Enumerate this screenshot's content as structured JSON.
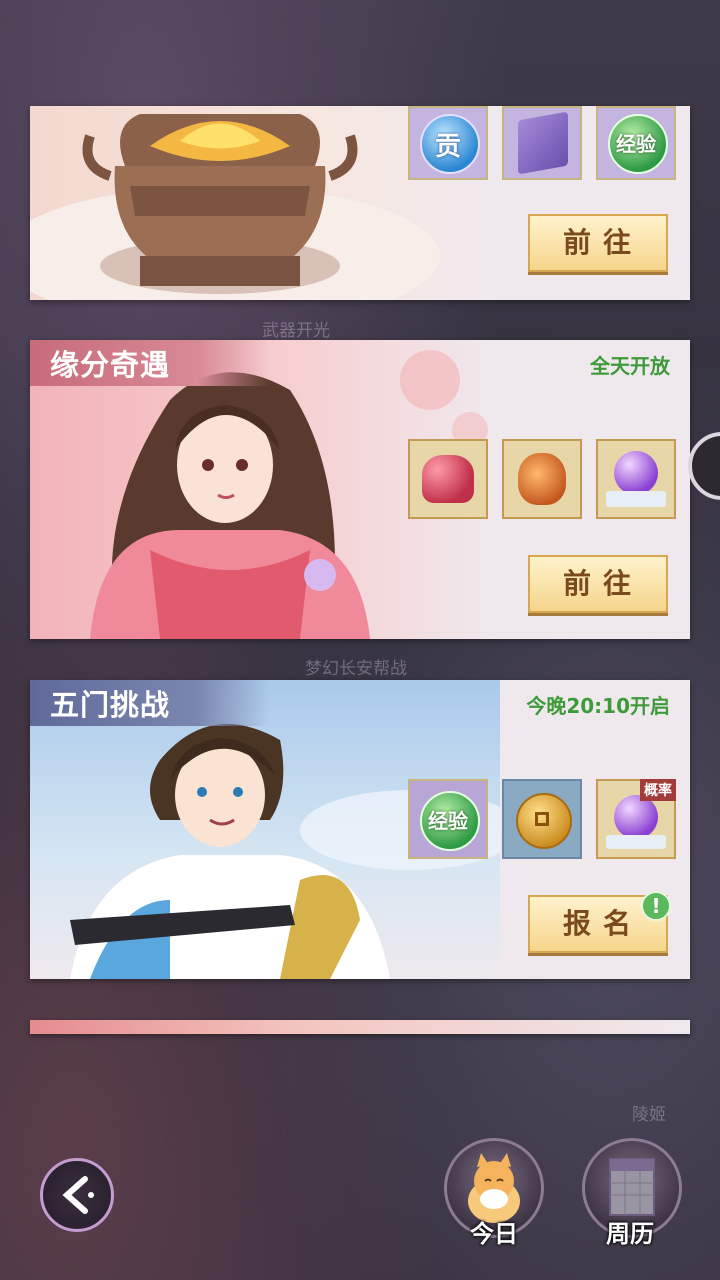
{
  "background_labels": {
    "weapon": "武器开光",
    "changan": "梦幻长安帮战",
    "npc": "陵姬"
  },
  "cards": [
    {
      "id": "weapon",
      "rewards": [
        {
          "icon": "contribution-icon",
          "text": "贡"
        },
        {
          "icon": "book-icon",
          "text": ""
        },
        {
          "icon": "experience-icon",
          "text": "经验"
        }
      ],
      "button": "前往"
    },
    {
      "id": "fate",
      "title": "缘分奇遇",
      "status": "全天开放",
      "rewards": [
        {
          "icon": "rose-box-icon"
        },
        {
          "icon": "money-bag-icon"
        },
        {
          "icon": "purple-orb-icon"
        }
      ],
      "button": "前往"
    },
    {
      "id": "five-gates",
      "title": "五门挑战",
      "status": "今晚20:10开启",
      "rewards": [
        {
          "icon": "experience-icon",
          "text": "经验"
        },
        {
          "icon": "coin-icon"
        },
        {
          "icon": "purple-orb-icon",
          "tag": "概率"
        }
      ],
      "button": "报名",
      "alert": "!"
    },
    {
      "id": "next",
      "title": "",
      "status": ""
    }
  ],
  "nav": {
    "today": "今日",
    "calendar": "周历"
  },
  "colors": {
    "status_green": "#3f9a3a",
    "fate_band": "#c86b7a",
    "five_band": "#5f6a9a",
    "button_text": "#7a4a1e"
  }
}
